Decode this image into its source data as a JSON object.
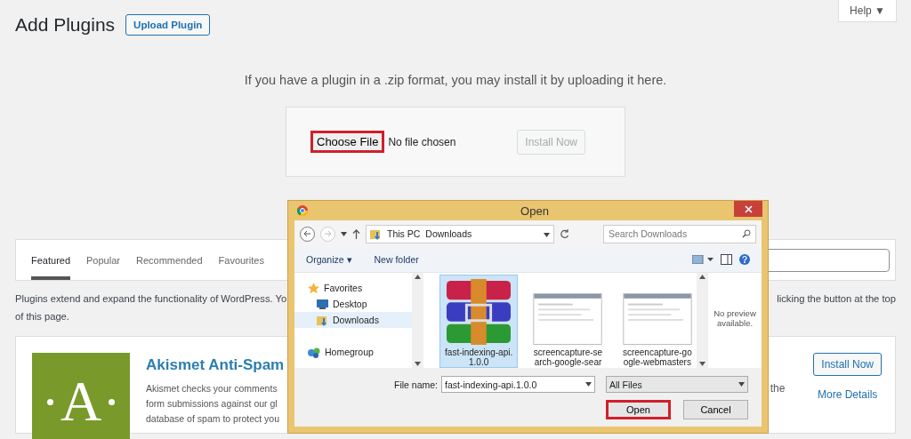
{
  "header": {
    "title": "Add Plugins",
    "upload_button": "Upload Plugin",
    "help": "Help ▼"
  },
  "upload": {
    "intro": "If you have a plugin in a .zip format, you may install it by uploading it here.",
    "choose_button": "Choose File",
    "choose_highlighted": true,
    "file_status": "No file chosen",
    "install_button": "Install Now",
    "install_disabled": true
  },
  "tabs": [
    {
      "label": "Featured",
      "selected": true
    },
    {
      "label": "Popular",
      "selected": false
    },
    {
      "label": "Recommended",
      "selected": false
    },
    {
      "label": "Favourites",
      "selected": false
    }
  ],
  "description": {
    "left": "Plugins extend and expand the functionality of WordPress. Yo",
    "right": "licking the button at the top",
    "line_2": "of this page."
  },
  "plugin_card": {
    "logo_letter": "A",
    "title": "Akismet Anti-Spam",
    "lines": [
      "Akismet checks your comments",
      "form submissions against our gl",
      "database of spam to protect you"
    ]
  },
  "plugin_card_2": {
    "fragment": "the",
    "install_button": "Install Now",
    "details_link": "More Details"
  },
  "dialog": {
    "title": "Open",
    "breadcrumb": [
      "This PC",
      "Downloads"
    ],
    "search_placeholder": "Search Downloads",
    "organize": "Organize ▾",
    "new_folder": "New folder",
    "nav": [
      {
        "label": "Favorites",
        "kind": "star",
        "selected": false
      },
      {
        "label": "Desktop",
        "kind": "desktop",
        "selected": false
      },
      {
        "label": "Downloads",
        "kind": "folder",
        "selected": true
      },
      {
        "label": "Homegroup",
        "kind": "network",
        "selected": false
      }
    ],
    "files": [
      {
        "name": "fast-indexing-api.1.0.0",
        "kind": "archive",
        "selected": true
      },
      {
        "name": "screencapture-search-google-sear",
        "kind": "screenshot",
        "selected": false
      },
      {
        "name": "screencapture-google-webmasters",
        "kind": "screenshot",
        "selected": false
      }
    ],
    "preview": "No preview available.",
    "file_name_label": "File name:",
    "file_name": "fast-indexing-api.1.0.0",
    "file_type": "All Files",
    "open_button": "Open",
    "open_highlighted": true,
    "cancel_button": "Cancel"
  }
}
